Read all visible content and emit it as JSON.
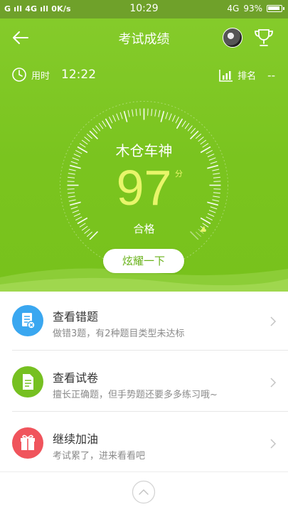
{
  "status_bar": {
    "left": "G ıll 4G ıll 0K/s",
    "time": "10:29",
    "network": "4G",
    "battery": "93%"
  },
  "header": {
    "title": "考试成绩"
  },
  "stats": {
    "time_label": "用时",
    "time_value": "12:22",
    "rank_label": "排名",
    "rank_value": "--"
  },
  "result": {
    "nickname": "木仓车神",
    "score": "97",
    "unit": "分",
    "grade": "合格",
    "share_label": "炫耀一下",
    "gauge_fraction": 0.97
  },
  "actions": [
    {
      "title": "查看错题",
      "subtitle": "做错3题，有2种题目类型未达标",
      "icon": "wrong-answers-icon",
      "color": "#3aa7f0"
    },
    {
      "title": "查看试卷",
      "subtitle": "擅长正确题，但手势题还要多多练习哦~",
      "icon": "paper-icon",
      "color": "#76c021"
    },
    {
      "title": "继续加油",
      "subtitle": "考试累了，进来看看吧",
      "icon": "gift-icon",
      "color": "#f0545c"
    }
  ],
  "colors": {
    "hero_green": "#7ac41f",
    "score_yellow": "#e8f56a"
  }
}
